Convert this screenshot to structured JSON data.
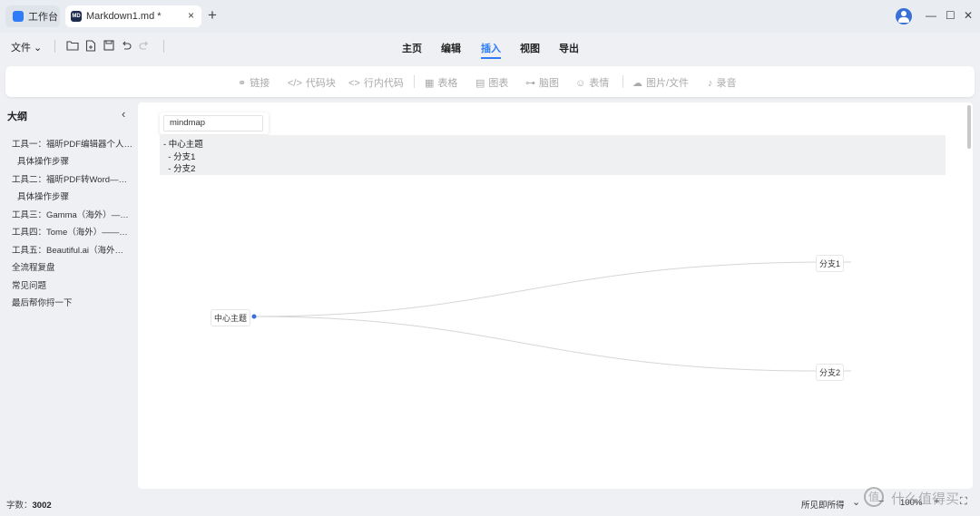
{
  "tabs": {
    "workbench": "工作台",
    "doc_icon": "MD",
    "doc_title": "Markdown1.md *",
    "close": "×",
    "new": "+"
  },
  "window": {
    "minimize": "—",
    "maximize": "☐",
    "close": "✕"
  },
  "toolbar": {
    "file_label": "文件 ⌄"
  },
  "top_menu": [
    {
      "label": "主页",
      "active": false
    },
    {
      "label": "编辑",
      "active": false
    },
    {
      "label": "插入",
      "active": true
    },
    {
      "label": "视图",
      "active": false
    },
    {
      "label": "导出",
      "active": false
    }
  ],
  "ribbon": [
    {
      "icon": "link-icon",
      "glyph": "🔗",
      "label": "链接"
    },
    {
      "icon": "code-icon",
      "glyph": "</>",
      "label": "代码块"
    },
    {
      "icon": "inline-code-icon",
      "glyph": "<>",
      "label": "行内代码"
    },
    {
      "icon": "table-icon",
      "glyph": "▦",
      "label": "表格"
    },
    {
      "icon": "chart-icon",
      "glyph": "▤",
      "label": "图表"
    },
    {
      "icon": "mindmap-icon",
      "glyph": "⊶",
      "label": "脑图"
    },
    {
      "icon": "emoji-icon",
      "glyph": "☺",
      "label": "表情"
    },
    {
      "icon": "upload-icon",
      "glyph": "☁",
      "label": "图片/文件"
    },
    {
      "icon": "mic-icon",
      "glyph": "🎙",
      "label": "录音"
    }
  ],
  "sidebar": {
    "title": "大纲",
    "collapse": "‹",
    "items": [
      {
        "label": "工具一：福昕PDF编辑器个人…",
        "indent": false
      },
      {
        "label": "具体操作步骤",
        "indent": true
      },
      {
        "label": "工具二：福昕PDF转Word—…",
        "indent": false
      },
      {
        "label": "具体操作步骤",
        "indent": true
      },
      {
        "label": "工具三：Gamma（海外）—…",
        "indent": false
      },
      {
        "label": "工具四：Tome（海外）——…",
        "indent": false
      },
      {
        "label": "工具五：Beautiful.ai（海外…",
        "indent": false
      },
      {
        "label": "全流程复盘",
        "indent": false
      },
      {
        "label": "常见问题",
        "indent": false
      },
      {
        "label": "最后帮你捋一下",
        "indent": false
      }
    ]
  },
  "editor": {
    "code_lang": "mindmap",
    "code_lines": [
      "- 中心主题",
      "  - 分支1",
      "  - 分支2"
    ],
    "mindmap": {
      "root": "中心主题",
      "branches": [
        "分支1",
        "分支2"
      ]
    }
  },
  "status": {
    "word_count_label": "字数：",
    "word_count": "3002",
    "mode": "所见即所得",
    "mode_chevron": "⌄",
    "zoom_out": "−",
    "zoom": "100%",
    "zoom_in": "+",
    "fullscreen": "⛶"
  },
  "watermark": {
    "logo": "值",
    "text": "什么值得买"
  },
  "colors": {
    "accent": "#2f7cf6",
    "brand_dark": "#1d2b4f"
  }
}
